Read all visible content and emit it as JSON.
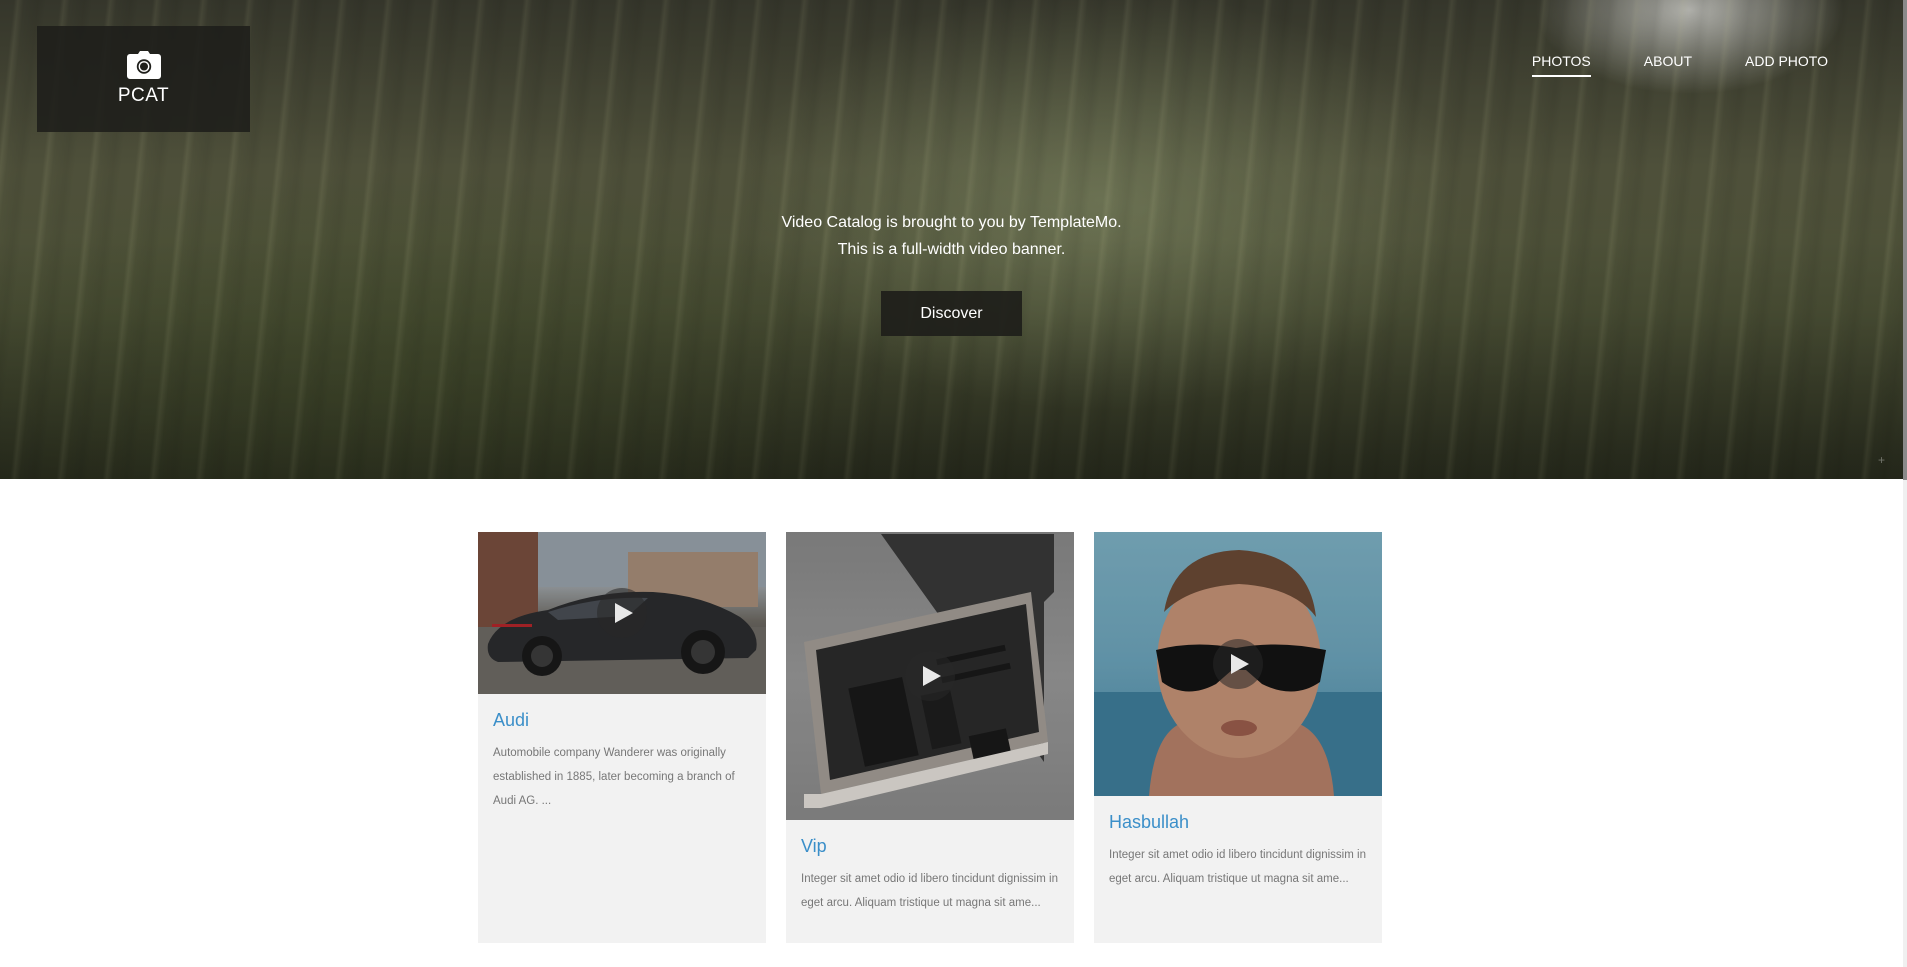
{
  "brand": {
    "name": "PCAT",
    "icon": "camera-icon"
  },
  "nav": {
    "items": [
      {
        "label": "PHOTOS",
        "active": true
      },
      {
        "label": "ABOUT",
        "active": false
      },
      {
        "label": "ADD PHOTO",
        "active": false
      }
    ]
  },
  "hero": {
    "line1": "Video Catalog is brought to you by TemplateMo.",
    "line2": "This is a full-width video banner.",
    "button_label": "Discover"
  },
  "cards": [
    {
      "title": "Audi",
      "description": "Automobile company Wanderer was originally established in 1885, later becoming a branch of Audi AG. ...",
      "media_icon": "play-icon"
    },
    {
      "title": "Vip",
      "description": "Integer sit amet odio id libero tincidunt dignissim in eget arcu. Aliquam tristique ut magna sit ame...",
      "media_icon": "play-icon"
    },
    {
      "title": "Hasbullah",
      "description": "Integer sit amet odio id libero tincidunt dignissim in eget arcu. Aliquam tristique ut magna sit ame...",
      "media_icon": "play-icon"
    }
  ],
  "colors": {
    "link_blue": "#3b8fc9",
    "card_bg": "#f2f2f2",
    "overlay_dark": "#1e1e1a"
  }
}
